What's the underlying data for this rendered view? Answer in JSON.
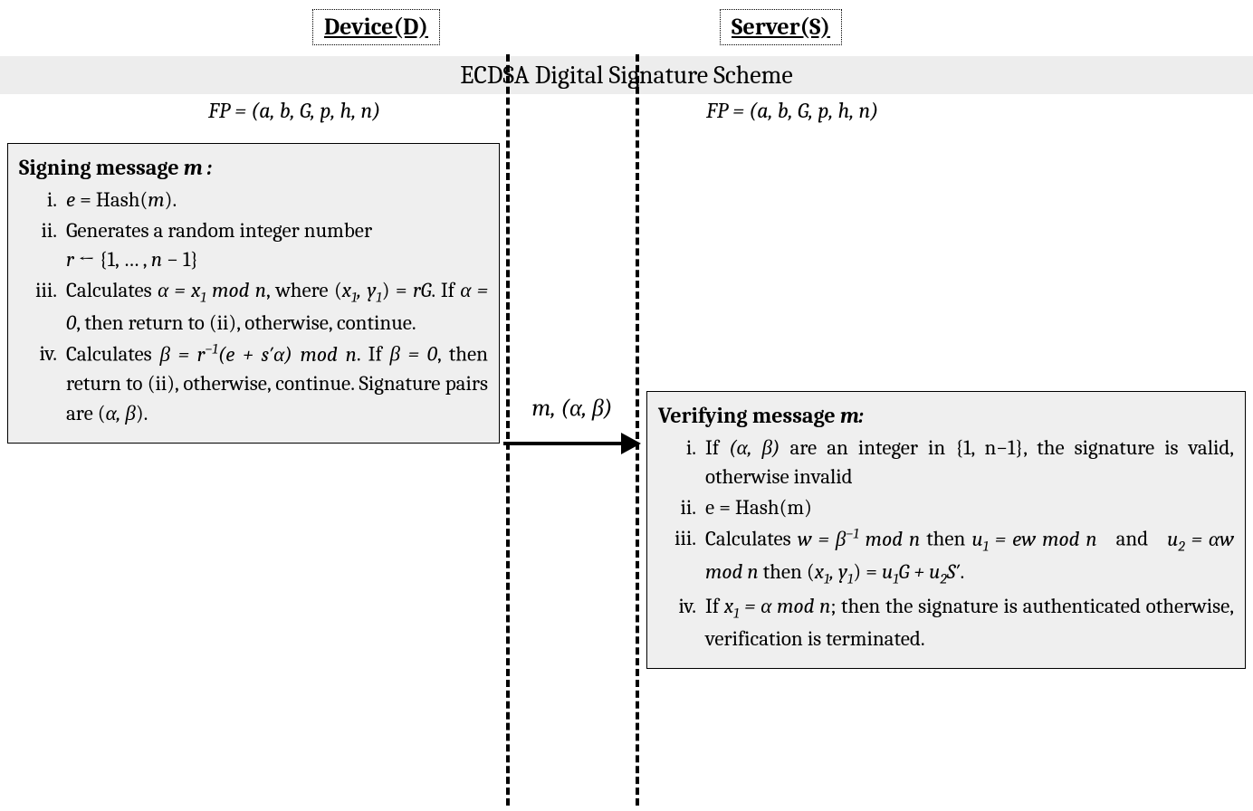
{
  "headers": {
    "device": "Device(D)",
    "server": "Server(S)"
  },
  "title": "ECDSA Digital Signature Scheme",
  "fp": {
    "left": "FP = (a, b, G, p, h, n)",
    "right": "FP = (a, b, G, p, h, n)"
  },
  "message_label": "m, (α, β)",
  "sign": {
    "title_prefix": "Signing message ",
    "title_var": "m :",
    "items": [
      {
        "num": "i.",
        "html": "<span class='math'>e</span> = Hash(<span class='math'>m</span>)."
      },
      {
        "num": "ii.",
        "html": "Generates a random integer number<br><span class='math'>r</span> ← {1, … , <span class='math'>n</span> − 1}"
      },
      {
        "num": "iii.",
        "html": "Calculates <span class='math'>α = x<sub>1</sub> mod n</span>, where (<span class='math'>x<sub>1</sub>, y<sub>1</sub></span>) = <span class='math'>rG</span>. If <span class='math'>α = 0</span>, then return to (ii), otherwise, continue."
      },
      {
        "num": "iv.",
        "html": "Calculates <span class='math'>β = r<sup>−1</sup>(e + s′α) mod n</span>. If <span class='math'>β = 0</span>, then return to (ii), otherwise, continue. Signature pairs are (<span class='math'>α, β</span>)."
      }
    ]
  },
  "verify": {
    "title_prefix": "Verifying message ",
    "title_var": "m:",
    "items": [
      {
        "num": "i.",
        "html": "If <span class='math'>(α, β)</span> are an integer in {1, n−1}, the signature is valid, otherwise invalid"
      },
      {
        "num": "ii.",
        "html": "e = Hash(m)"
      },
      {
        "num": "iii.",
        "html": "Calculates <span class='math'>w = β<sup>−1</sup> mod n</span> then <span class='math'>u<sub>1</sub> = ew mod n</span>&nbsp;&nbsp;&nbsp;and&nbsp;&nbsp;&nbsp;<span class='math'>u<sub>2</sub> = αw mod n</span> then (<span class='math'>x<sub>1</sub>, y<sub>1</sub></span>) = <span class='math'>u<sub>1</sub>G + u<sub>2</sub>S′</span>."
      },
      {
        "num": "iv.",
        "html": "If <span class='math'>x<sub>1</sub> = α mod n</span>; then the signature is authenticated otherwise, verification is terminated."
      }
    ]
  }
}
